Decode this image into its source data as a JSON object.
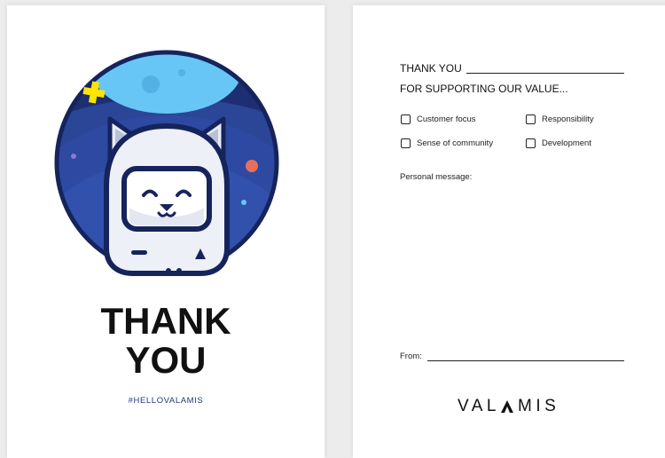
{
  "front": {
    "title_line1": "THANK",
    "title_line2": "YOU",
    "hashtag": "#HELLOVALAMIS",
    "illustration_icon": "astronaut-cat-icon"
  },
  "back": {
    "heading1": "THANK YOU",
    "heading2": "FOR SUPPORTING OUR VALUE...",
    "checkboxes": [
      {
        "label": "Customer focus",
        "checked": false
      },
      {
        "label": "Responsibility",
        "checked": false
      },
      {
        "label": "Sense of community",
        "checked": false
      },
      {
        "label": "Development",
        "checked": false
      }
    ],
    "message_label": "Personal message:",
    "from_label": "From:",
    "brand_left": "VAL",
    "brand_right": "MIS",
    "brand_logo_icon": "valamis-a-logo-icon"
  },
  "colors": {
    "planet_dark": "#1a2a63",
    "planet_mid": "#2f4fa3",
    "moon": "#67c6f5",
    "star": "#ffe500",
    "planet_red": "#e8705a",
    "text_dark": "#111111",
    "hashtag": "#1f3a7a"
  }
}
